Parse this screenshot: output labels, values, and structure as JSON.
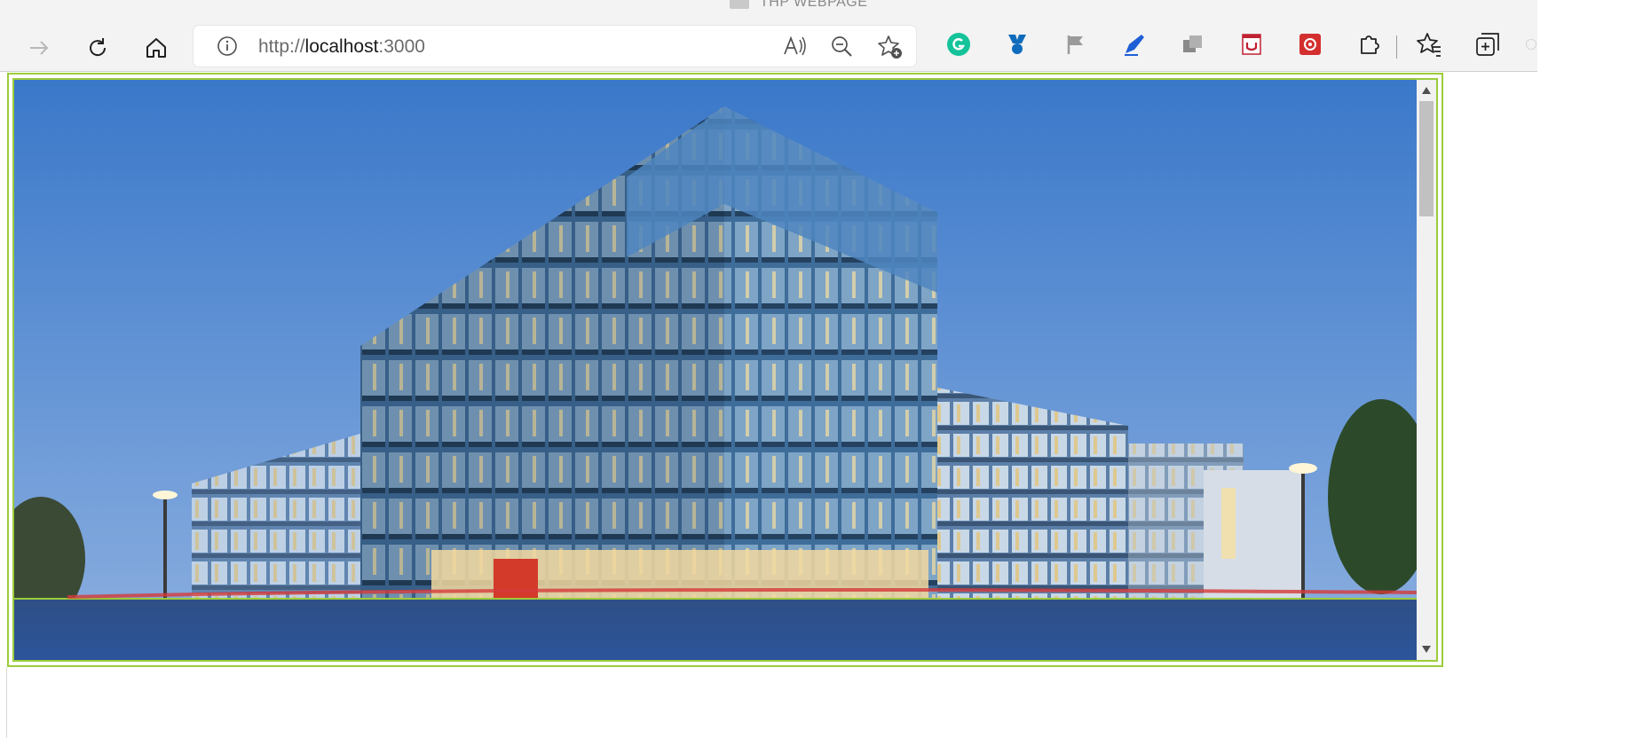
{
  "window": {
    "title": "THP WEBPAGE"
  },
  "toolbar": {
    "url_scheme": "http://",
    "url_host": "localhost",
    "url_port": ":3000"
  },
  "icons": {
    "back": "arrow-right-icon",
    "refresh": "refresh-icon",
    "home": "home-icon",
    "site_info": "info-icon",
    "read_aloud": "read-aloud-icon",
    "zoom": "zoom-out-icon",
    "add_favorite": "star-add-icon",
    "favorites": "favorites-icon",
    "collections": "collections-icon"
  },
  "extensions": [
    "grammarly-icon",
    "badge-extension-icon",
    "flag-extension-icon",
    "pen-extension-icon",
    "copy-extension-icon",
    "shield-extension-icon",
    "red-extension-icon",
    "puzzle-icon"
  ],
  "colors": {
    "frame_border": "#9ccc3a",
    "sky_top": "#3f7fd0",
    "sky_bottom": "#7fa8dc",
    "road": "#2a4f86"
  }
}
